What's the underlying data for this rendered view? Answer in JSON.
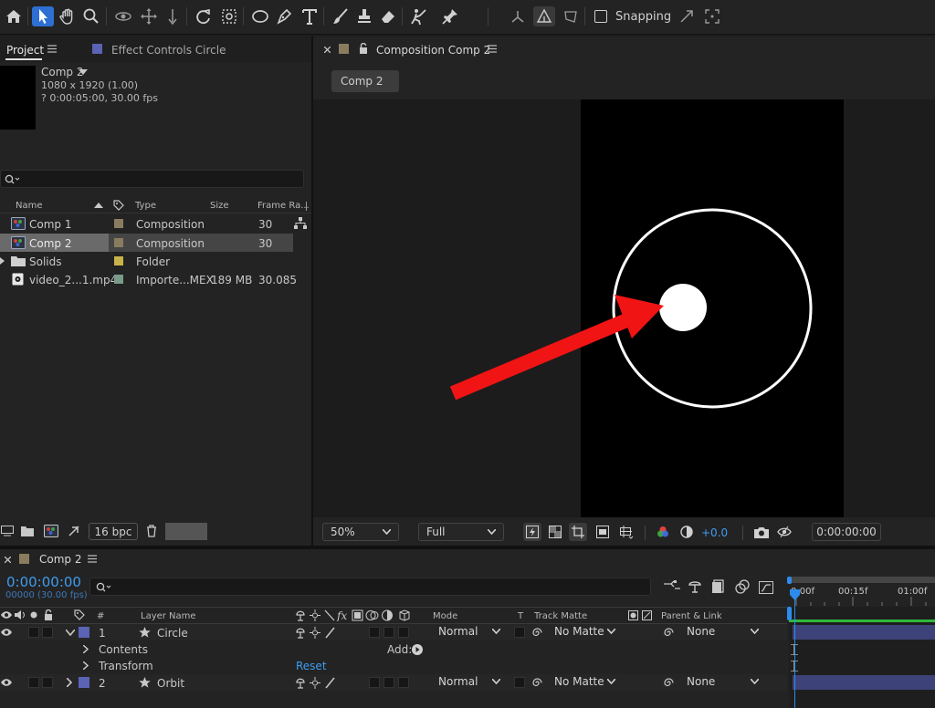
{
  "toolbar": {
    "snapping_label": "Snapping"
  },
  "project_panel": {
    "tab_label": "Project",
    "effect_controls_label": "Effect Controls Circle",
    "selected_name": "Comp 2",
    "selected_dims": "1080 x 1920 (1.00)",
    "selected_duration": "? 0:00:05:00, 30.00 fps",
    "search_placeholder": "",
    "columns": {
      "name": "Name",
      "type": "Type",
      "size": "Size",
      "frame_rate": "Frame Ra..."
    },
    "items": [
      {
        "name": "Comp 1",
        "type": "Composition",
        "size": "",
        "frame_rate": "30",
        "label_color": "#8a7c5e",
        "kind": "comp"
      },
      {
        "name": "Comp 2",
        "type": "Composition",
        "size": "",
        "frame_rate": "30",
        "label_color": "#8a7c5e",
        "kind": "comp"
      },
      {
        "name": "Solids",
        "type": "Folder",
        "size": "",
        "frame_rate": "",
        "label_color": "#c8b24a",
        "kind": "folder"
      },
      {
        "name": "video_2...1.mp4",
        "type": "Importe...MEX",
        "size": "189 MB",
        "frame_rate": "30.085",
        "label_color": "#7a9a8a",
        "kind": "video"
      }
    ],
    "bpc_label": "16 bpc"
  },
  "comp_panel": {
    "tab_label": "Composition Comp 2",
    "breadcrumb": "Comp 2",
    "zoom": "50%",
    "resolution": "Full",
    "exposure": "+0.0",
    "timecode": "0:00:00:00"
  },
  "timeline": {
    "tab_label": "Comp 2",
    "timecode": "0:00:00:00",
    "frames_fps": "00000 (30.00 fps)",
    "ruler": [
      "0:00f",
      "00:15f",
      "01:00f"
    ],
    "columns": {
      "num": "#",
      "layer_name": "Layer Name",
      "mode": "Mode",
      "t": "T",
      "track_matte": "Track Matte",
      "parent": "Parent & Link"
    },
    "layers": [
      {
        "num": "1",
        "name": "Circle",
        "mode": "Normal",
        "matte": "No Matte",
        "parent": "None",
        "color": "#5b63b5",
        "expanded": true
      },
      {
        "num": "2",
        "name": "Orbit",
        "mode": "Normal",
        "matte": "No Matte",
        "parent": "None",
        "color": "#5b63b5",
        "expanded": false
      }
    ],
    "contents_label": "Contents",
    "add_label": "Add:",
    "transform_label": "Transform",
    "reset_label": "Reset"
  },
  "colors": {
    "accent_blue": "#2d8ceb",
    "timecode_blue": "#3e9cf0",
    "arrow_red": "#f01414",
    "layer_bar": "#3d4378"
  }
}
